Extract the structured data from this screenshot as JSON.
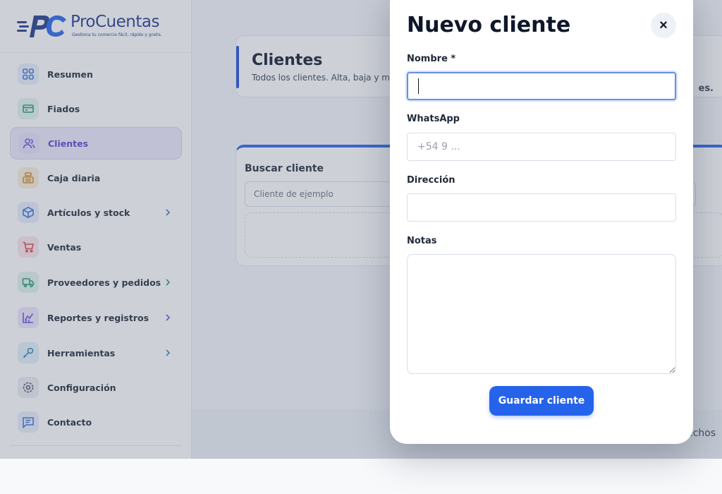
{
  "brand": {
    "name": "ProCuentas",
    "tagline": "Gestiona tu comercio fácil, rápido y gratis.",
    "colors": {
      "primary": "#1e3a8a",
      "accent": "#2563eb",
      "active": "#5b3fd6"
    }
  },
  "sidebar": {
    "items": [
      {
        "label": "Resumen",
        "icon": "grid-icon",
        "chevron": false
      },
      {
        "label": "Fiados",
        "icon": "cash-icon",
        "chevron": false
      },
      {
        "label": "Clientes",
        "icon": "users-icon",
        "chevron": false,
        "active": true
      },
      {
        "label": "Caja diaria",
        "icon": "cash-register-icon",
        "chevron": false
      },
      {
        "label": "Artículos y stock",
        "icon": "box-icon",
        "chevron": true
      },
      {
        "label": "Ventas",
        "icon": "cart-icon",
        "chevron": false
      },
      {
        "label": "Proveedores y pedidos",
        "icon": "truck-icon",
        "chevron": true
      },
      {
        "label": "Reportes y registros",
        "icon": "chart-icon",
        "chevron": true
      },
      {
        "label": "Herramientas",
        "icon": "wrench-icon",
        "chevron": true
      },
      {
        "label": "Configuración",
        "icon": "gear-icon",
        "chevron": false
      },
      {
        "label": "Contacto",
        "icon": "message-icon",
        "chevron": false
      }
    ]
  },
  "page": {
    "title": "Clientes",
    "subtitle": "Todos los clientes. Alta, baja y mod"
  },
  "search": {
    "title": "Buscar cliente",
    "placeholder": "Cliente de ejemplo",
    "result_text": "es."
  },
  "footer": {
    "text": "echos"
  },
  "modal": {
    "title": "Nuevo cliente",
    "close_label": "×",
    "fields": {
      "name_label": "Nombre *",
      "name_value": "",
      "whatsapp_label": "WhatsApp",
      "whatsapp_placeholder": "+54 9 ...",
      "address_label": "Dirección",
      "address_value": "",
      "notes_label": "Notas",
      "notes_value": ""
    },
    "save_label": "Guardar cliente"
  }
}
